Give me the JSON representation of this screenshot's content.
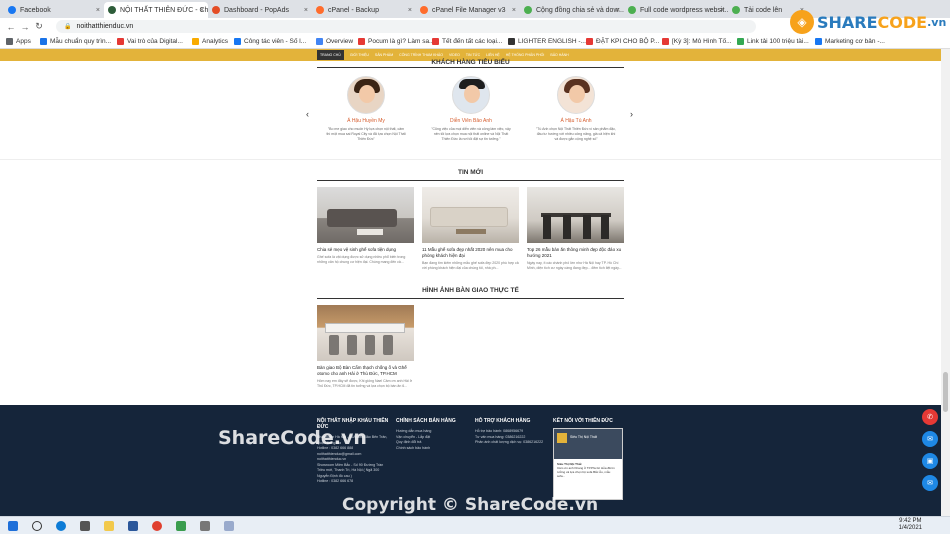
{
  "browser": {
    "tabs": [
      {
        "label": "Facebook",
        "color": "#1877f2"
      },
      {
        "label": "NỘI THẤT THIÊN ĐỨC - Ch...",
        "color": "#2e5d3a"
      },
      {
        "label": "Dashboard - PopAds",
        "color": "#e44d26"
      },
      {
        "label": "cPanel - Backup",
        "color": "#ff6c2c"
      },
      {
        "label": "cPanel File Manager v3",
        "color": "#ff6c2c"
      },
      {
        "label": "Cộng đồng chia sẻ và dow...",
        "color": "#4caf50"
      },
      {
        "label": "Full code wordpress websit...",
        "color": "#4caf50"
      },
      {
        "label": "Tải code lên",
        "color": "#4caf50"
      }
    ],
    "url": "noithatthienduc.vn",
    "bookmarks": [
      {
        "label": "Apps",
        "color": "#5f6368"
      },
      {
        "label": "Mẫu chuẩn quy trìn...",
        "color": "#1a73e8"
      },
      {
        "label": "Vai trò của Digital...",
        "color": "#e53935"
      },
      {
        "label": "Analytics",
        "color": "#f9ab00"
      },
      {
        "label": "Công tác viên - Số l...",
        "color": "#1877f2"
      },
      {
        "label": "Overview",
        "color": "#4285f4"
      },
      {
        "label": "Pocum là gì? Làm sa...",
        "color": "#e53935"
      },
      {
        "label": "Tết đến tất các loại...",
        "color": "#e53935"
      },
      {
        "label": "LIGHTER ENGLISH -...",
        "color": "#333333"
      },
      {
        "label": "ĐẶT KPI CHO BỘ P...",
        "color": "#e53935"
      },
      {
        "label": "[Kỳ 3]: Mô Hình Tố...",
        "color": "#e53935"
      },
      {
        "label": "Link tải 100 triệu tài...",
        "color": "#34a853"
      },
      {
        "label": "Marketing cơ bản -...",
        "color": "#1877f2"
      }
    ]
  },
  "watermark": {
    "logo_text_1": "SHARE",
    "logo_text_2": "CODE",
    "logo_suffix": ".vn",
    "center_text": "ShareCode.vn",
    "copyright_text": "Copyright © ShareCode.vn"
  },
  "site": {
    "nav": [
      "TRANG CHỦ",
      "GIỚI THIỆU",
      "SẢN PHẨM",
      "CÔNG TRÌNH THAM KHẢO",
      "VIDEO",
      "TIN TỨC",
      "LIÊN HỆ",
      "HỆ THỐNG PHÂN PHỐI",
      "BẢO HÀNH"
    ],
    "testimonials_title": "KHÁCH HÀNG TIÊU BIỂU",
    "testimonials": [
      {
        "name": "Á Hậu Huyền My",
        "quote": "\"Bo me giao cho muốn Hỷ lựa chọn nội thất, cảm thì một mua sai Royal City và đã lựa chọn Nội Thất Thiên Đức\""
      },
      {
        "name": "Diễn Viên Bảo Anh",
        "quote": "\"Cũng việc của mọi diễn viên và công làm việc, vậy nên tôi lựa chọn mua nội thất online và Nội Thất Thiên Đức là nơi tôi đặt sự tin tưởng.\""
      },
      {
        "name": "Á Hậu Tú Anh",
        "quote": "\"Tú Anh chọn Nội Thất Thiên Đức vì sản phẩm đặc, đầu tư hướng với nhiều công năng, giá cả hiện khi và được gắn cộng nghệ số\""
      }
    ],
    "news_title": "TIN MỚI",
    "news": [
      {
        "title": "Chia sẻ mẹo vệ sinh ghế sofa tiện dụng",
        "excerpt": "Ghế sofa là vật dụng được sử dụng nhiều phổ biến trong những căn hộ chung cư hiện đại. Chúng mang đến cả..."
      },
      {
        "title": "11 Mẫu ghế sofa đẹp nhất 2020 nên mua cho phòng khách hiện đại",
        "excerpt": "Bạn đang tìm kiếm những mẫu ghế sofa đẹp 2020 phù hợp cả với phòng khách hiện đại của chúng tôi, nhà ph..."
      },
      {
        "title": "Top 26 mẫu bàn ăn thông minh đẹp độc đáo xu hướng 2021",
        "excerpt": "Ngày nay, ít các chành phố lớn như Hà Nội hay TP. Hồ Chí Minh, diện tích cư ngày càng đang đẹp... đêm tích liệt ngày..."
      }
    ],
    "handover_title": "HÌNH ẢNH BÀN GIAO THỰC TẾ",
    "handover": [
      {
        "title": "Bàn giao Bộ Bàn Cẩm thạch chống ố và Ghế otomo cho anh Hải ở Thủ Đức, TP.HCM",
        "excerpt": "Hôm nay em đây sẽ được, Khi giống Nael Cảm ơn anh Hải ở Thủ Đức, TP.HCM đã tin tưởng và lựa chọn bộ bàn ăn 6..."
      }
    ],
    "footer": {
      "col1_title": "NỘI THẤT NHẬP KHẨU THIÊN ĐỨC",
      "col1_lines": [
        "Showroom Hà Nội - 15A Liên Bảo Bến Trân, Quận Đống Đa",
        "Hotline : 0382 666 888",
        "noithatthienduc@gmail.com",
        "noithatthienduc.vn",
        "Showroom Miền Bắc - Số 90 Đường Trần Triều mới, Thanh Trì, Hà Nội ( Ngã 300 Nguyễn Định đồ cau )",
        "Hotline : 0382 666 678"
      ],
      "col2_title": "CHÍNH SÁCH BÁN HÀNG",
      "col2_lines": [
        "Hướng dẫn mua hàng",
        "Vận chuyển - Lắp đặt",
        "Quy định đổi trả",
        "Chính sách bảo hành"
      ],
      "col3_title": "HỖ TRỢ KHÁCH HÀNG",
      "col3_lines": [
        "Hỗ trợ bảo hành: 0868956679",
        "Tư vấn mua hàng: 0386216222",
        "Phản ánh chất lượng dịch vụ: 0386216222"
      ],
      "col4_title": "KẾT NỐI VỚI THIÊN ĐỨC",
      "fb_page": "Siêu Thị Nội Thất",
      "fb_post": "Cảm ơn anh Khang ở TP.Phước Hỏa đã tin tưởng và lựa chọn bộ sofa Bắc Âu, mẫu sofa..."
    }
  },
  "taskbar": {
    "time": "9:42 PM",
    "date": "1/4/2021"
  }
}
